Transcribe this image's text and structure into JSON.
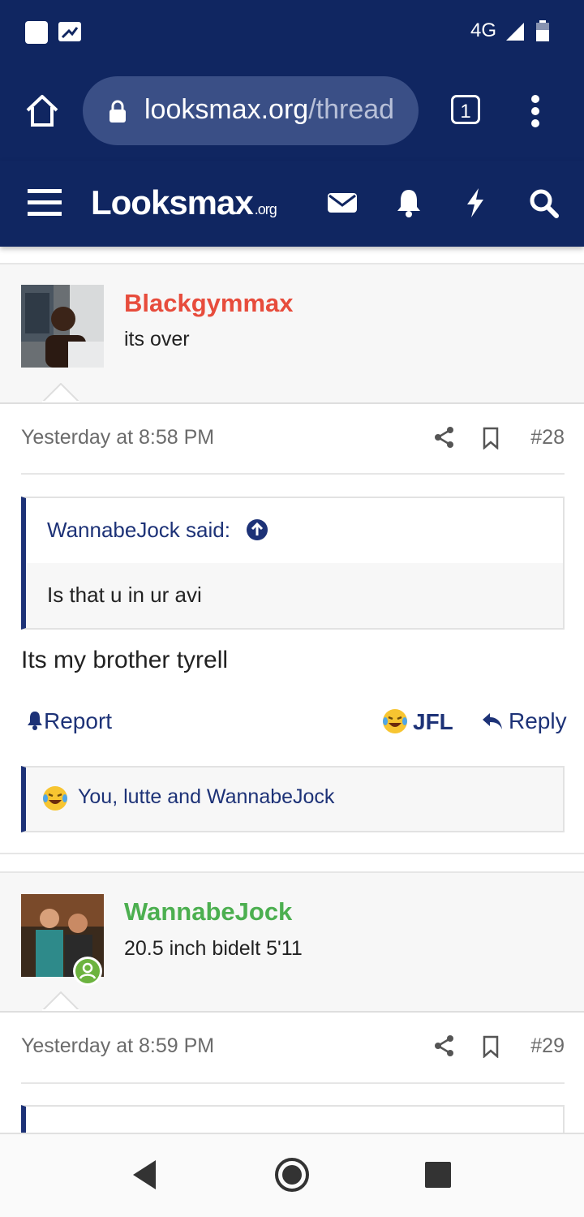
{
  "status_bar": {
    "network": "4G"
  },
  "browser": {
    "url_host": "looksmax.org",
    "url_path": "/thread",
    "tab_count": "1"
  },
  "site": {
    "logo_main": "Looksmax",
    "logo_suffix": ".org"
  },
  "posts": [
    {
      "username": "Blackgymmax",
      "username_color": "#e74c3c",
      "user_title": "its over",
      "date": "Yesterday at 8:58 PM",
      "number": "#28",
      "quote_author": "WannabeJock said:",
      "quote_text": "Is that u in ur avi",
      "message": "Its my brother tyrell",
      "report_label": "Report",
      "reaction_label": "JFL",
      "reply_label": "Reply",
      "reactions_text": "You, lutte and WannabeJock"
    },
    {
      "username": "WannabeJock",
      "username_color": "#4caf50",
      "user_title": "20.5 inch bidelt 5'11",
      "date": "Yesterday at 8:59 PM",
      "number": "#29"
    }
  ]
}
